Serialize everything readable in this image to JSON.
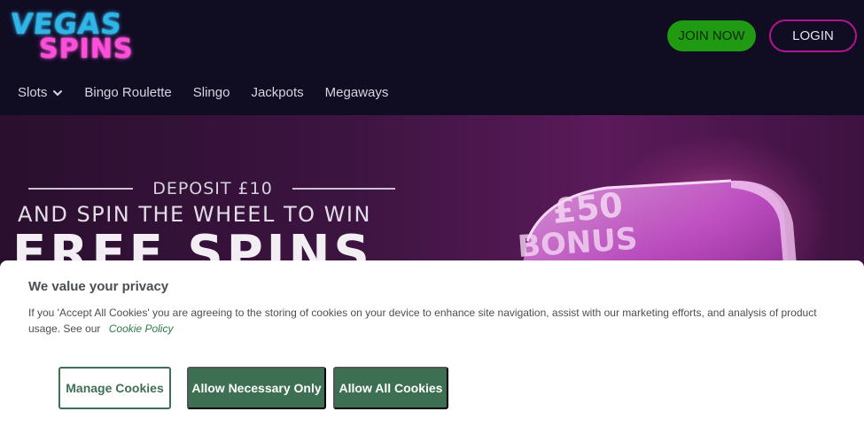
{
  "logo": {
    "line1": "VEGAS",
    "line2": "SPINS"
  },
  "header": {
    "join_label": "JOIN NOW",
    "login_label": "LOGIN"
  },
  "nav": {
    "items": [
      {
        "label": "Slots"
      },
      {
        "label": "Bingo Roulette"
      },
      {
        "label": "Slingo"
      },
      {
        "label": "Jackpots"
      },
      {
        "label": "Megaways"
      }
    ]
  },
  "banner": {
    "deposit": "DEPOSIT £10",
    "spin_text": "AND SPIN THE WHEEL TO WIN",
    "free_spins": "FREE SPINS",
    "wheel_amount": "£50",
    "wheel_label": "BONUS"
  },
  "cookie": {
    "title": "We value your privacy",
    "text": "If you 'Accept All Cookies' you are agreeing to the storing of cookies on your device to enhance site navigation, assist with our marketing efforts, and analysis of product usage. See our",
    "link_label": "Cookie Policy",
    "manage_label": "Manage Cookies",
    "necessary_label": "Allow Necessary Only",
    "all_label": "Allow All Cookies"
  },
  "colors": {
    "brand_green": "#1f9a12",
    "brand_magenta": "#b3148f",
    "cookie_green": "#3d6f52",
    "header_bg": "#100c22"
  }
}
